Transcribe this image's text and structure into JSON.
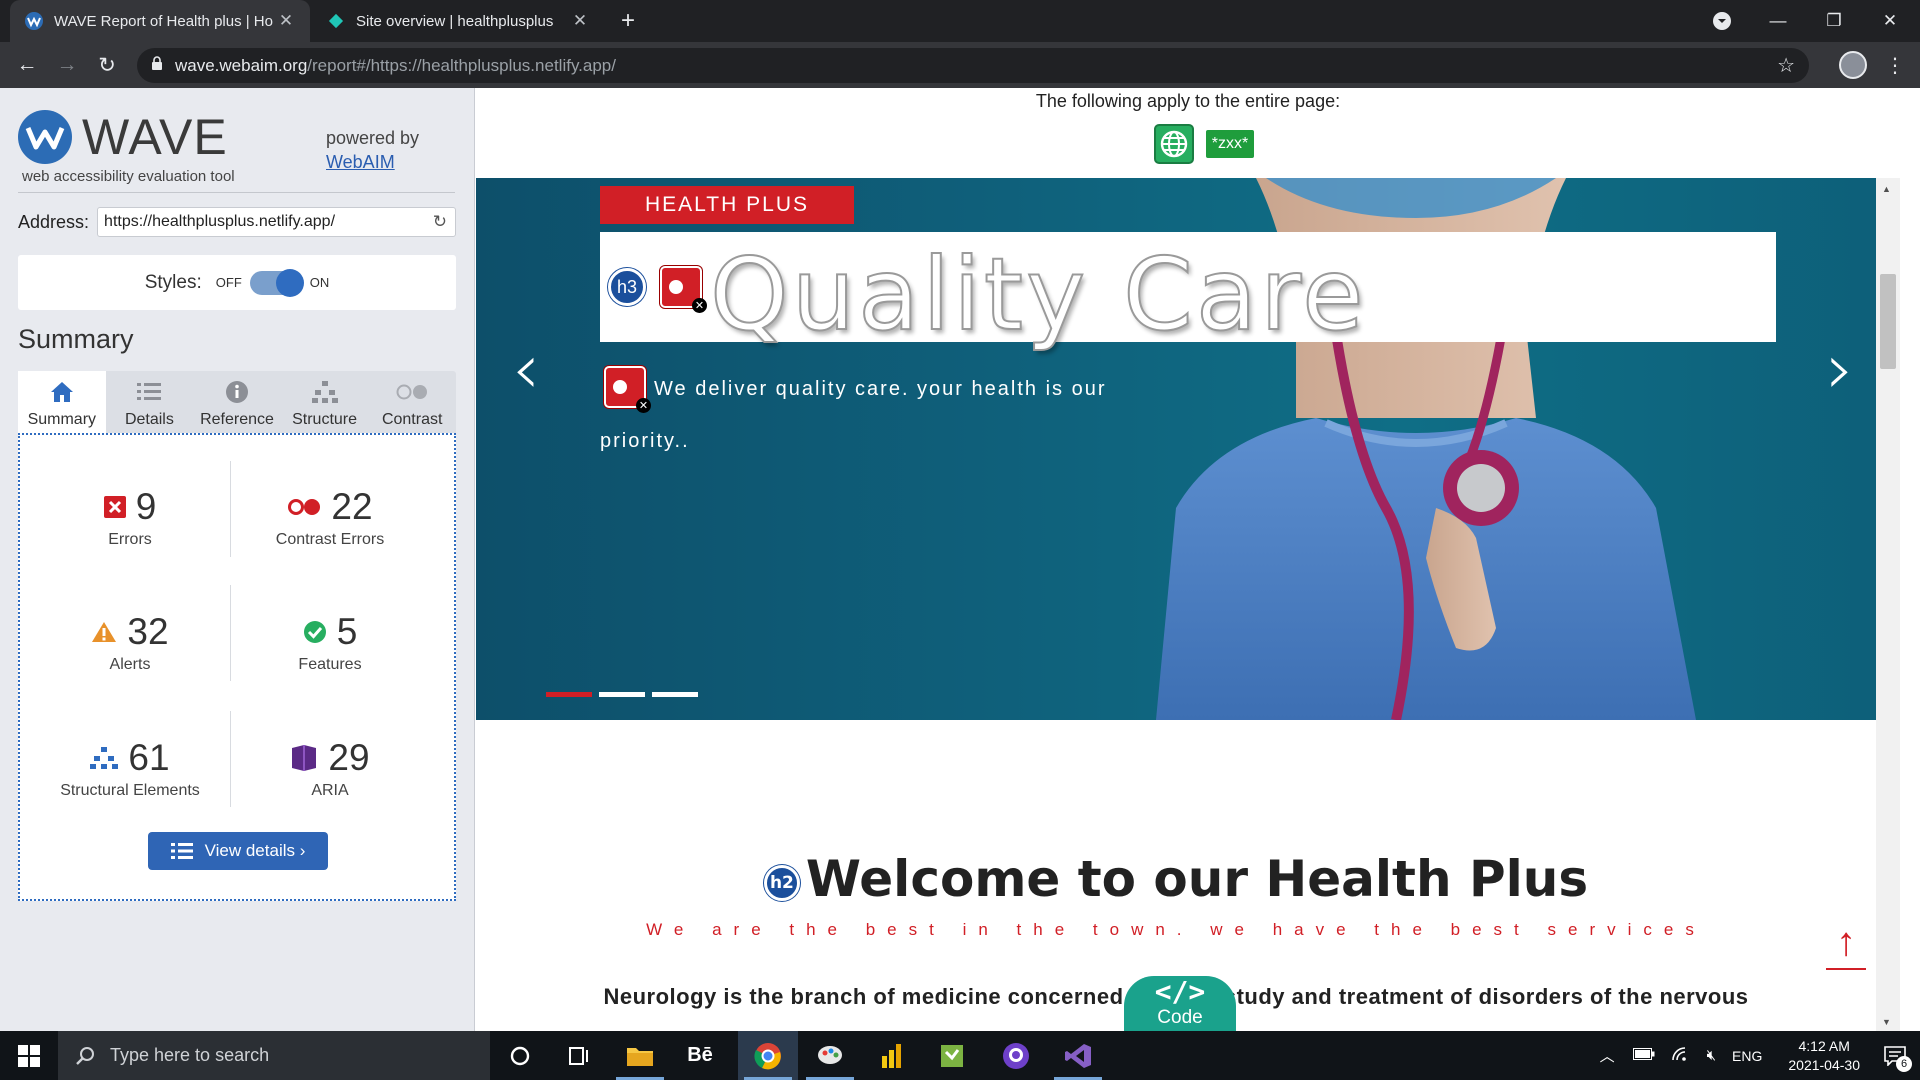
{
  "browser": {
    "tabs": [
      {
        "title": "WAVE Report of Health plus | Ho",
        "active": true
      },
      {
        "title": "Site overview | healthplusplus",
        "active": false
      }
    ],
    "url_domain": "wave.webaim.org",
    "url_path": "/report#/https://healthplusplus.netlify.app/"
  },
  "wave": {
    "logo_text": "WAVE",
    "tagline": "web accessibility evaluation tool",
    "powered_by": "powered by",
    "webaim_link": "WebAIM",
    "address_label": "Address:",
    "address_value": "https://healthplusplus.netlify.app/",
    "styles_label": "Styles:",
    "styles_off": "OFF",
    "styles_on": "ON",
    "styles_enabled": true,
    "summary_heading": "Summary",
    "tabs": [
      "Summary",
      "Details",
      "Reference",
      "Structure",
      "Contrast"
    ],
    "stats": {
      "errors": {
        "value": "9",
        "label": "Errors"
      },
      "contrast": {
        "value": "22",
        "label": "Contrast Errors"
      },
      "alerts": {
        "value": "32",
        "label": "Alerts"
      },
      "features": {
        "value": "5",
        "label": "Features"
      },
      "structural": {
        "value": "61",
        "label": "Structural Elements"
      },
      "aria": {
        "value": "29",
        "label": "ARIA"
      }
    },
    "view_details": "View details ›"
  },
  "page": {
    "apply_text": "The following apply to the entire page:",
    "lang_badge": "*zxx*",
    "hero": {
      "badge": "HEALTH PLUS",
      "title": "Quality Care",
      "heading_marker": "h3",
      "description": "We deliver quality care. your health is our priority..",
      "active_slide": 1,
      "slide_count": 3
    },
    "welcome_marker": "h2",
    "welcome": "Welcome to our Health Plus",
    "tagline": "We are the best in the town. we have the best services",
    "neuro_text": "Neurology is the branch of medicine concerned with the study and treatment of disorders of the nervous",
    "code_badge_symbol": "</>",
    "code_badge_text": "Code"
  },
  "taskbar": {
    "search_placeholder": "Type here to search",
    "lang": "ENG",
    "time": "4:12 AM",
    "date": "2021-04-30",
    "notifications": "6"
  },
  "colors": {
    "wave_blue": "#2f6cc0",
    "error_red": "#d11f26",
    "feature_green": "#27ae60",
    "hero_teal": "#0f6e86"
  }
}
